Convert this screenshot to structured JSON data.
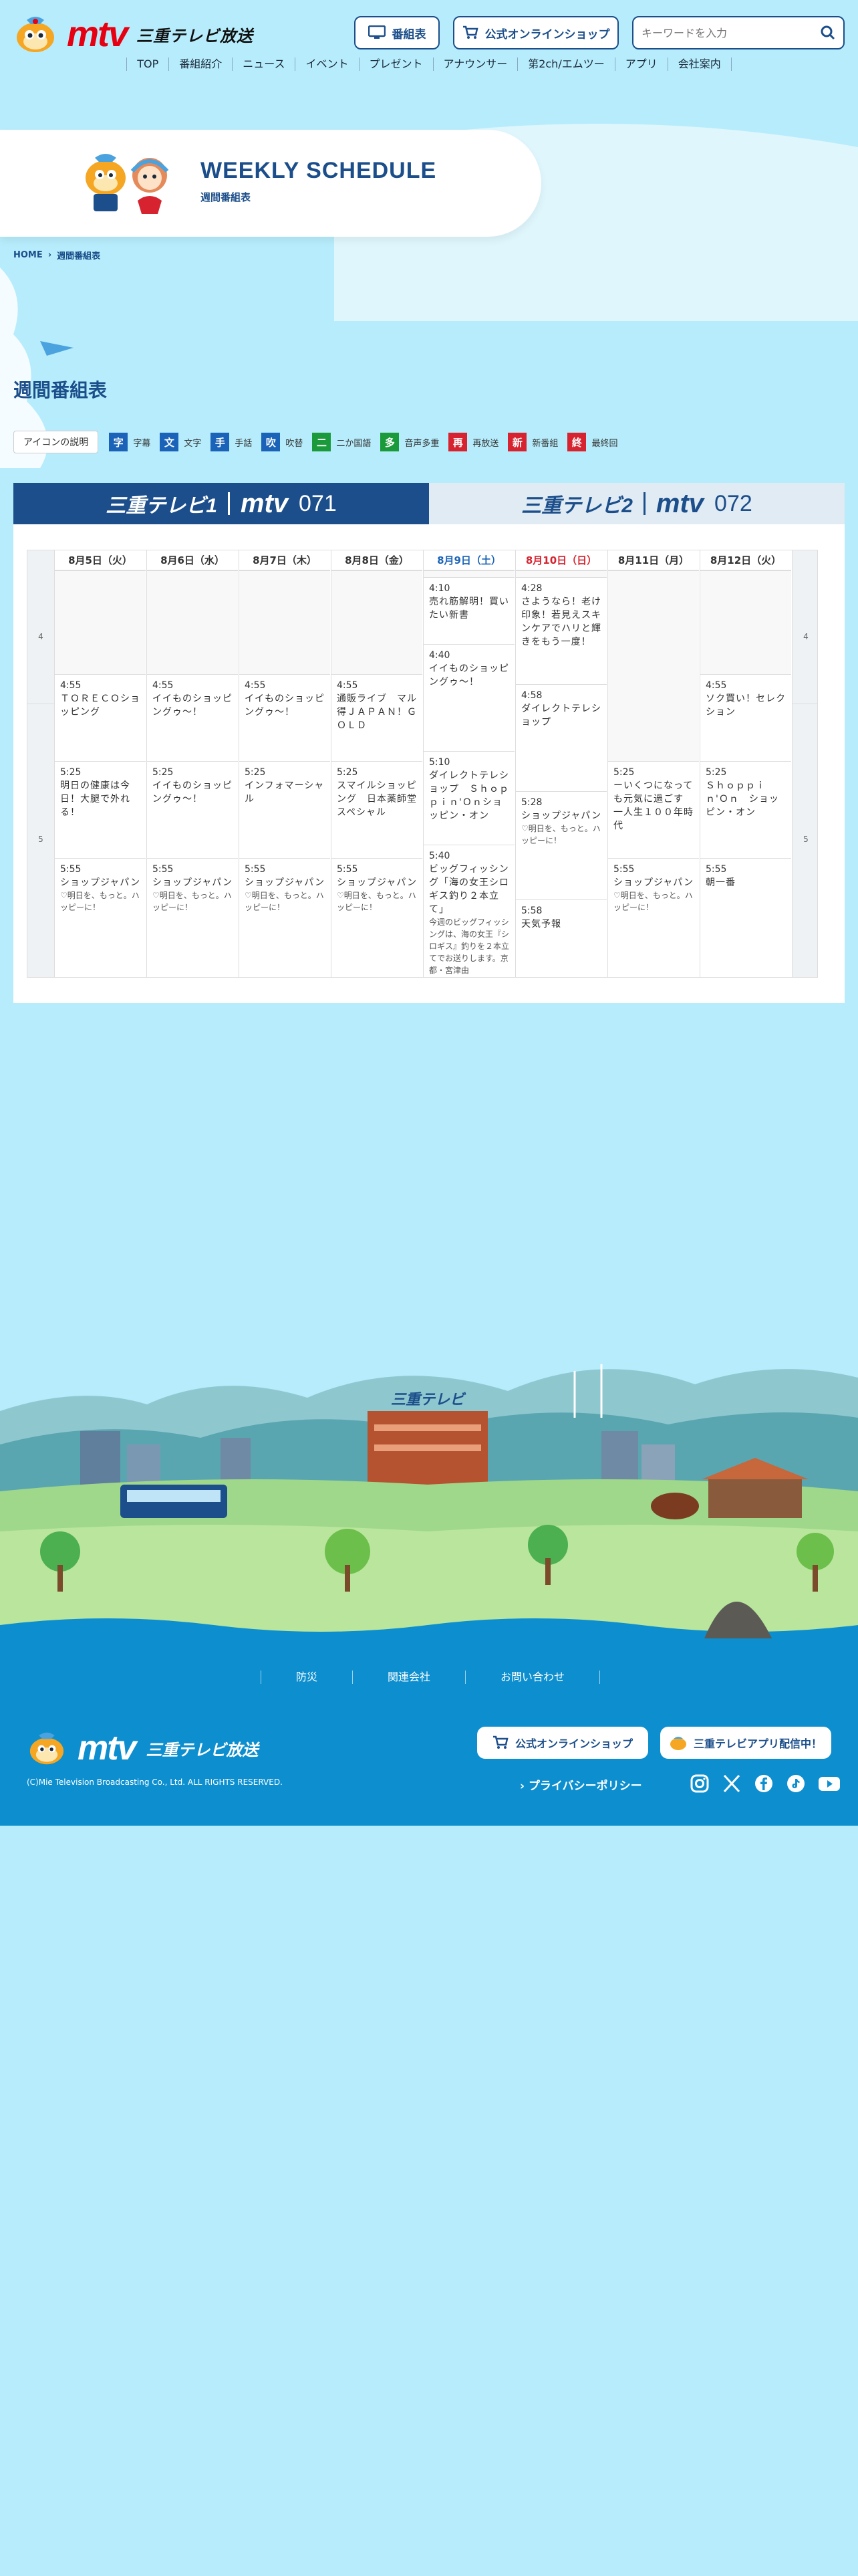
{
  "header": {
    "brand": "mtv",
    "brand_sub": "三重テレビ放送",
    "program_button": "番組表",
    "shop_button": "公式オンラインショップ",
    "search_placeholder": "キーワードを入力"
  },
  "nav": [
    "TOP",
    "番組紹介",
    "ニュース",
    "イベント",
    "プレゼント",
    "アナウンサー",
    "第2ch/エムツー",
    "アプリ",
    "会社案内"
  ],
  "hero": {
    "title": "WEEKLY SCHEDULE",
    "subtitle": "週間番組表"
  },
  "breadcrumb": {
    "home": "HOME",
    "current": "週間番組表"
  },
  "page_title": "週間番組表",
  "legend": {
    "button": "アイコンの説明",
    "items": [
      {
        "icon": "字",
        "label": "字幕",
        "color": "#1a63b8"
      },
      {
        "icon": "文",
        "label": "文字",
        "color": "#1a63b8"
      },
      {
        "icon": "手",
        "label": "手話",
        "color": "#1a63b8"
      },
      {
        "icon": "吹",
        "label": "吹替",
        "color": "#1a63b8"
      },
      {
        "icon": "二",
        "label": "二か国語",
        "color": "#1a9a3a"
      },
      {
        "icon": "多",
        "label": "音声多重",
        "color": "#1a9a3a"
      },
      {
        "icon": "再",
        "label": "再放送",
        "color": "#d6232f"
      },
      {
        "icon": "新",
        "label": "新番組",
        "color": "#d6232f"
      },
      {
        "icon": "終",
        "label": "最終回",
        "color": "#d6232f"
      }
    ]
  },
  "tabs": [
    {
      "name": "三重テレビ1",
      "logo": "mtv",
      "number": "071"
    },
    {
      "name": "三重テレビ2",
      "logo": "mtv",
      "number": "072"
    }
  ],
  "schedule": {
    "hours": [
      "4",
      "5"
    ],
    "days": [
      {
        "label": "8月5日（火）",
        "color": "#333",
        "programs": [
          {
            "time": "4:55",
            "title": "ＴＯＲＥＣＯショッピング",
            "desc": ""
          },
          {
            "time": "5:25",
            "title": "明日の健康は今日！大腿で外れる！",
            "desc": ""
          },
          {
            "time": "5:55",
            "title": "ショップジャパン",
            "desc": "♡明日を、もっと。ハッピーに！"
          }
        ]
      },
      {
        "label": "8月6日（水）",
        "color": "#333",
        "programs": [
          {
            "time": "4:55",
            "title": "イイものショッピングゥ～！",
            "desc": ""
          },
          {
            "time": "5:25",
            "title": "イイものショッピングゥ～！",
            "desc": ""
          },
          {
            "time": "5:55",
            "title": "ショップジャパン",
            "desc": "♡明日を、もっと。ハッピーに！"
          }
        ]
      },
      {
        "label": "8月7日（木）",
        "color": "#333",
        "programs": [
          {
            "time": "4:55",
            "title": "イイものショッピングゥ～！",
            "desc": ""
          },
          {
            "time": "5:25",
            "title": "インフォマーシャル",
            "desc": ""
          },
          {
            "time": "5:55",
            "title": "ショップジャパン",
            "desc": "♡明日を、もっと。ハッピーに！"
          }
        ]
      },
      {
        "label": "8月8日（金）",
        "color": "#333",
        "programs": [
          {
            "time": "4:55",
            "title": "通販ライブ　マル得ＪＡＰＡＮ！ＧＯＬＤ",
            "desc": ""
          },
          {
            "time": "5:25",
            "title": "スマイルショッピング　日本薬師堂スペシャル",
            "desc": ""
          },
          {
            "time": "5:55",
            "title": "ショップジャパン",
            "desc": "♡明日を、もっと。ハッピーに！"
          }
        ]
      },
      {
        "label": "8月9日（土）",
        "color": "#1a63b8",
        "programs": [
          {
            "time": "4:10",
            "title": "売れ筋解明！買いたい新書",
            "desc": ""
          },
          {
            "time": "4:40",
            "title": "イイものショッピングゥ～！",
            "desc": ""
          },
          {
            "time": "5:10",
            "title": "ダイレクトテレショップ　Ｓｈｏｐｐｉｎ'Ｏｎショッピン・オン",
            "desc": ""
          },
          {
            "time": "5:40",
            "title": "ビッグフィッシング「海の女王シロギス釣り２本立て」",
            "desc": "今週のビッグフィッシングは、海の女王『シロギス』釣りを２本立てでお送りします。京都・宮津由"
          }
        ]
      },
      {
        "label": "8月10日（日）",
        "color": "#d6232f",
        "programs": [
          {
            "time": "4:28",
            "title": "さようなら！老け印象！若見えスキンケアでハリと輝きをもう一度！",
            "desc": ""
          },
          {
            "time": "4:58",
            "title": "ダイレクトテレショップ",
            "desc": ""
          },
          {
            "time": "5:28",
            "title": "ショップジャパン",
            "desc": "♡明日を、もっと。ハッピーに！"
          },
          {
            "time": "5:58",
            "title": "天気予報",
            "desc": ""
          }
        ]
      },
      {
        "label": "8月11日（月）",
        "color": "#333",
        "programs": [
          {
            "time": "5:25",
            "title": "ーいくつになっても元気に過ごす一人生１００年時代",
            "desc": ""
          },
          {
            "time": "5:55",
            "title": "ショップジャパン",
            "desc": "♡明日を、もっと。ハッピーに！"
          }
        ]
      },
      {
        "label": "8月12日（火）",
        "color": "#333",
        "programs": [
          {
            "time": "4:55",
            "title": "ソク買い！セレクション",
            "desc": ""
          },
          {
            "time": "5:25",
            "title": "Ｓｈｏｐｐｉｎ'Ｏｎ　ショッピン・オン",
            "desc": ""
          },
          {
            "time": "5:55",
            "title": "朝一番",
            "desc": ""
          }
        ]
      }
    ]
  },
  "footer": {
    "links": [
      "防災",
      "関連会社",
      "お問い合わせ"
    ],
    "brand": "mtv",
    "brand_sub": "三重テレビ放送",
    "copyright": "(C)Mie Television Broadcasting Co., Ltd. ALL RIGHTS RESERVED.",
    "shop_button": "公式オンラインショップ",
    "app_button": "三重テレビアプリ配信中！",
    "privacy": "プライバシーポリシー",
    "illustration_sign": "三重テレビ"
  },
  "colors": {
    "brand_red": "#e60012",
    "navy": "#1b4e8a",
    "sky": "#b6ecfb",
    "footer_blue": "#0d8fcf"
  }
}
